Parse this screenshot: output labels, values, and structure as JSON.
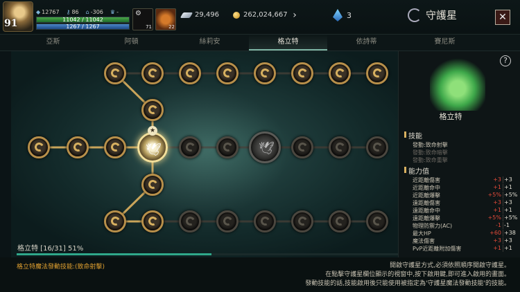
{
  "player": {
    "level": "91",
    "stat_a": "12767",
    "stat_b": "86",
    "stat_c": "-306",
    "stat_d": "-",
    "hp_text": "11042 / 11042",
    "hp_fraction": 1.0,
    "mp_text": "1267 / 1267",
    "mp_fraction": 1.0
  },
  "slots": {
    "slot1_count": "71",
    "slot2_count": "22"
  },
  "currency": {
    "feathers": "29,496",
    "gold": "262,024,667",
    "gems": "3"
  },
  "header": {
    "title": "守護星",
    "close": "✕"
  },
  "tabs": [
    "亞斯",
    "阿頓",
    "絲莉安",
    "格立特",
    "依詩蒂",
    "賽尼斯"
  ],
  "active_tab": 3,
  "tree": {
    "progress_label": "格立特 [16/31] 51%",
    "progress_fraction": 0.51,
    "star": "★"
  },
  "panel": {
    "help": "?",
    "name": "格立特",
    "skills_heading": "技能",
    "skills": [
      {
        "label": "發動:致命射擊",
        "unlocked": true
      },
      {
        "label": "發動:致命暗擊",
        "unlocked": false
      },
      {
        "label": "發動:致命重擊",
        "unlocked": false
      }
    ],
    "stats_heading": "能力值",
    "stats": [
      {
        "label": "近距離傷害",
        "delta": "+3",
        "total": "+3"
      },
      {
        "label": "近距離命中",
        "delta": "+1",
        "total": "+1"
      },
      {
        "label": "近距離爆擊",
        "delta": "+5%",
        "total": "+5%"
      },
      {
        "label": "遠距離傷害",
        "delta": "+3",
        "total": "+3"
      },
      {
        "label": "遠距離命中",
        "delta": "+1",
        "total": "+1"
      },
      {
        "label": "遠距離爆擊",
        "delta": "+5%",
        "total": "+5%"
      },
      {
        "label": "物理防禦力(AC)",
        "delta": "-1",
        "total": "-1"
      },
      {
        "label": "最大HP",
        "delta": "+60",
        "total": "+38"
      },
      {
        "label": "魔法傷害",
        "delta": "+3",
        "total": "+3"
      },
      {
        "label": "PvP近距離附加傷害",
        "delta": "+1",
        "total": "+1"
      }
    ]
  },
  "footer": {
    "magic_skill": "格立特魔法發動技能:(致命射擊)",
    "line1": "開啟守護星方式,必須依照順序開啟守護星。",
    "line2": "在點擊守護星欄位顯示的視窗中,按下啟用鍵,即可進入啟用的畫面。",
    "line3": "發動技能的話,技能啟用後只能使用被指定為'守護星魔法發動技能'的技能。"
  },
  "colors": {
    "accent": "#2fa88a",
    "gold_border": "#b78f4a",
    "bonus_red": "#e24a3a",
    "skill_orange": "#e0a030"
  }
}
